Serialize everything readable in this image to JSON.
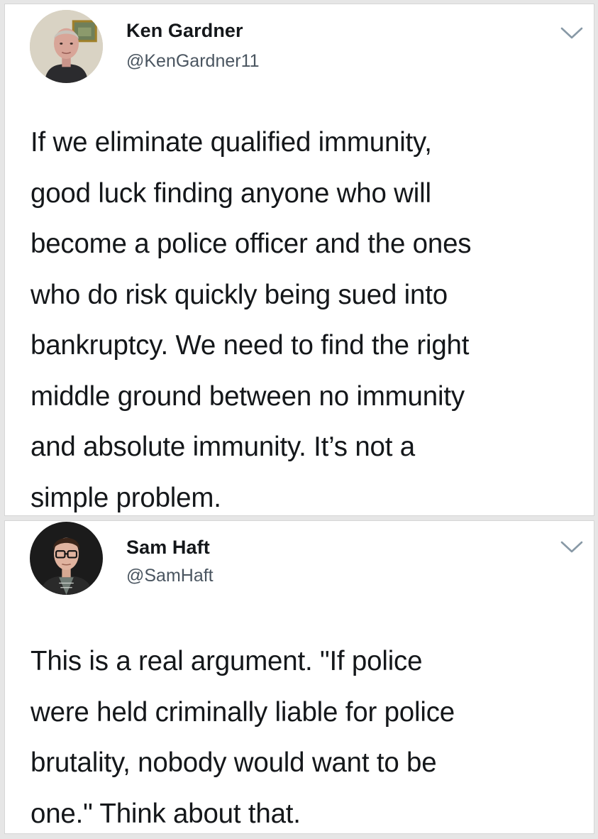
{
  "tweets": [
    {
      "display_name": "Ken Gardner",
      "handle": "@KenGardner11",
      "text": "If we eliminate qualified immunity,\ngood luck finding anyone who will\nbecome a police officer and the ones\nwho do risk quickly being sued into\nbankruptcy. We need to find the right\nmiddle ground between no immunity\nand absolute immunity. It’s not a\nsimple problem."
    },
    {
      "display_name": "Sam Haft",
      "handle": "@SamHaft",
      "text": "This is a real argument. \"If police\nwere held criminally liable for police\nbrutality, nobody would want to be\none.\" Think about that."
    }
  ],
  "icons": {
    "menu": "chevron-down-icon"
  },
  "colors": {
    "background": "#e6e6e6",
    "card": "#ffffff",
    "text": "#14171a",
    "handle": "#4a5560",
    "chevron": "#8899a6"
  }
}
